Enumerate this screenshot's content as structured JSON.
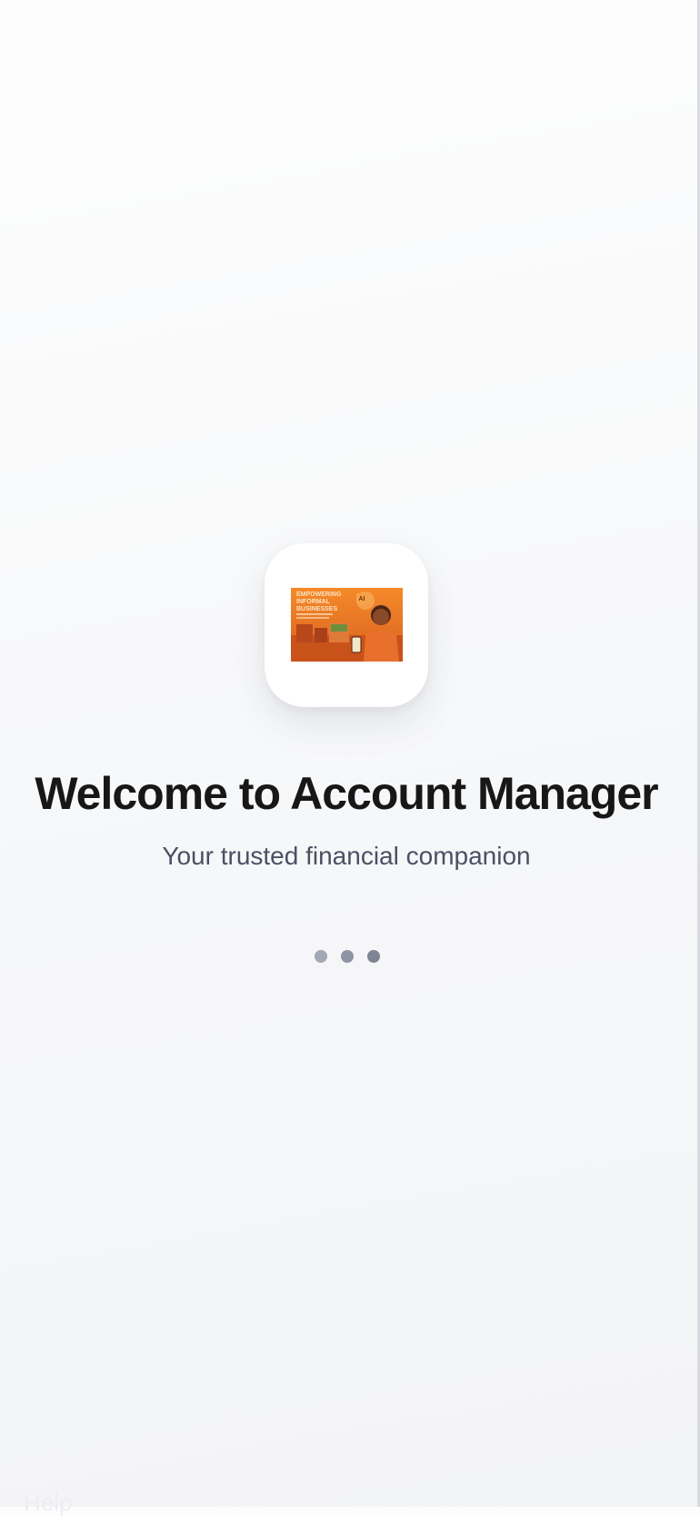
{
  "app": {
    "logo": {
      "headline_lines": [
        "EMPOWERING",
        "INFORMAL",
        "BUSINESSES"
      ],
      "badge": "AI",
      "accent_colors": [
        "#f08a2b",
        "#d9591c",
        "#fbb25a"
      ]
    },
    "title": "Welcome to Account Manager",
    "subtitle": "Your trusted financial companion",
    "loader": {
      "dot_count": 3,
      "color": "#8c93a3"
    },
    "footer_text": "Help"
  },
  "colors": {
    "background": "#f7f8fa",
    "title": "#171717",
    "subtitle": "#4b5163",
    "card": "#ffffff"
  }
}
